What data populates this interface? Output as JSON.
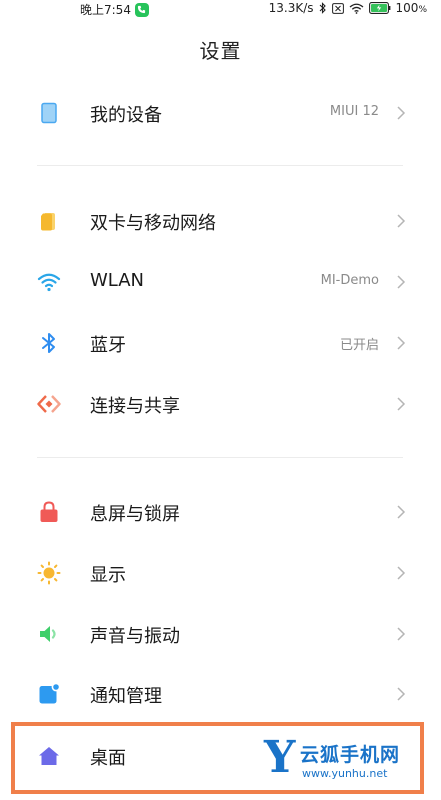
{
  "status_bar": {
    "time": "晚上7:54",
    "speed": "13.3K/s",
    "battery": "100",
    "battery_unit": "%"
  },
  "page_title": "设置",
  "sections": [
    [
      {
        "key": "device",
        "label": "我的设备",
        "value": "MIUI 12",
        "icon": "device-icon",
        "color": "#4aa8f0"
      }
    ],
    [
      {
        "key": "sim",
        "label": "双卡与移动网络",
        "value": "",
        "icon": "sim-card-icon",
        "color": "#f5b82e"
      },
      {
        "key": "wlan",
        "label": "WLAN",
        "value": "MI-Demo",
        "icon": "wifi-icon",
        "color": "#2aa6e8"
      },
      {
        "key": "bluetooth",
        "label": "蓝牙",
        "value": "已开启",
        "icon": "bluetooth-icon",
        "color": "#2f8df0"
      },
      {
        "key": "share",
        "label": "连接与共享",
        "value": "",
        "icon": "connection-share-icon",
        "color": "#ef6a4a"
      }
    ],
    [
      {
        "key": "lock",
        "label": "息屏与锁屏",
        "value": "",
        "icon": "lock-icon",
        "color": "#f05a57"
      },
      {
        "key": "display",
        "label": "显示",
        "value": "",
        "icon": "sun-icon",
        "color": "#f7b731"
      },
      {
        "key": "sound",
        "label": "声音与振动",
        "value": "",
        "icon": "speaker-icon",
        "color": "#3fcf6b"
      },
      {
        "key": "notify",
        "label": "通知管理",
        "value": "",
        "icon": "notification-icon",
        "color": "#2d9af0"
      },
      {
        "key": "home",
        "label": "桌面",
        "value": "",
        "icon": "home-icon",
        "color": "#6c6ae8"
      }
    ]
  ],
  "watermark": {
    "letter": "Y",
    "name": "云狐手机网",
    "url": "www.yunhu.net"
  },
  "highlight_color": "#f07f4a"
}
